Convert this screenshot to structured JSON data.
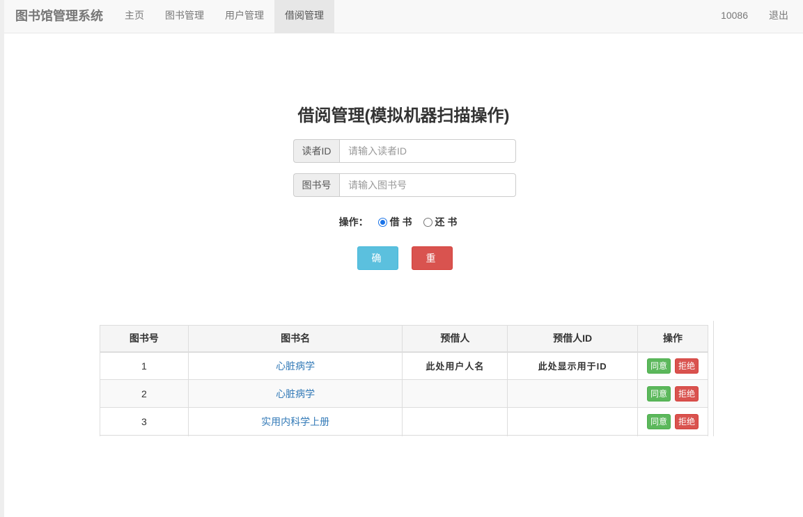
{
  "navbar": {
    "brand": "图书馆管理系统",
    "items": [
      {
        "label": "主页"
      },
      {
        "label": "图书管理"
      },
      {
        "label": "用户管理"
      },
      {
        "label": "借阅管理"
      }
    ],
    "user_id": "10086",
    "logout": "退出"
  },
  "form": {
    "title": "借阅管理(模拟机器扫描操作)",
    "reader_label": "读者ID",
    "reader_placeholder": "请输入读者ID",
    "book_label": "图书号",
    "book_placeholder": "请输入图书号",
    "op_label": "操作：",
    "borrow_label": "借 书",
    "return_label": "还 书",
    "selected": "borrow",
    "confirm_label": "确 定",
    "reset_label": "重 置"
  },
  "table": {
    "headers": [
      "图书号",
      "图书名",
      "预借人",
      "预借人ID",
      "操作"
    ],
    "rows": [
      {
        "id": "1",
        "name": "心脏病学",
        "borrower": "此处用户人名",
        "borrower_id": "此处显示用于ID",
        "agree": "同意",
        "reject": "拒绝"
      },
      {
        "id": "2",
        "name": "心脏病学",
        "borrower": "",
        "borrower_id": "",
        "agree": "同意",
        "reject": "拒绝"
      },
      {
        "id": "3",
        "name": "实用内科学上册",
        "borrower": "",
        "borrower_id": "",
        "agree": "同意",
        "reject": "拒绝"
      }
    ]
  },
  "colors": {
    "info": "#5bc0de",
    "danger": "#d9534f",
    "success": "#5cb85c",
    "link": "#337ab7"
  }
}
